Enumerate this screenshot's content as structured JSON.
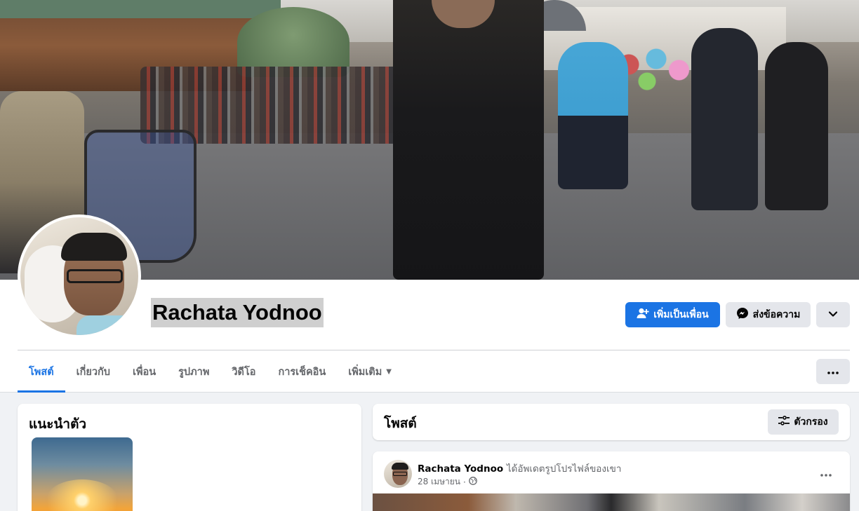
{
  "profile": {
    "name": "Rachata Yodnoo"
  },
  "actions": {
    "add_friend_label": "เพิ่มเป็นเพื่อน",
    "message_label": "ส่งข้อความ"
  },
  "tabs": [
    {
      "label": "โพสต์",
      "active": true
    },
    {
      "label": "เกี่ยวกับ",
      "active": false
    },
    {
      "label": "เพื่อน",
      "active": false
    },
    {
      "label": "รูปภาพ",
      "active": false
    },
    {
      "label": "วิดีโอ",
      "active": false
    },
    {
      "label": "การเช็คอิน",
      "active": false
    },
    {
      "label": "เพิ่มเติม",
      "active": false
    }
  ],
  "intro": {
    "title": "แนะนำตัว"
  },
  "posts": {
    "title": "โพสต์",
    "filter_label": "ตัวกรอง"
  },
  "post": {
    "author": "Rachata Yodnoo",
    "action": "ได้อัพเดตรูปโปรไฟล์ของเขา",
    "date": "28 เมษายน",
    "separator": "·",
    "privacy_icon": "globe-icon"
  },
  "colors": {
    "accent": "#1b74e4",
    "secondary_button": "#e4e6eb",
    "page_bg": "#f0f2f5"
  }
}
